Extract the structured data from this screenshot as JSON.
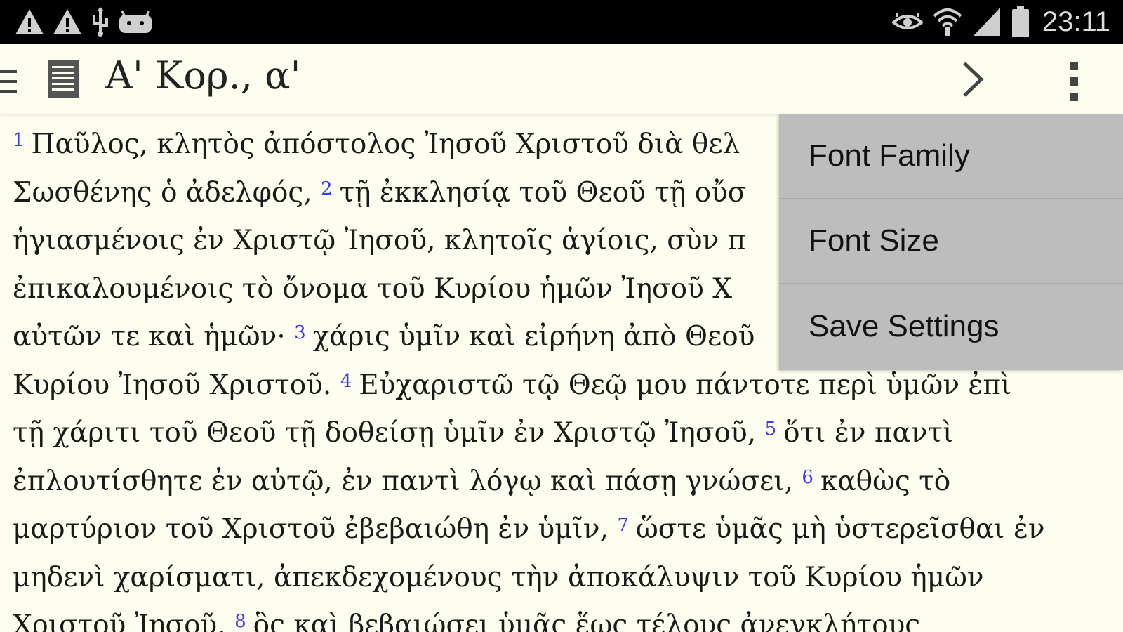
{
  "status_bar": {
    "icons_left": [
      "warning-icon",
      "warning-icon",
      "usb-icon",
      "android-debug-icon"
    ],
    "icons_right": [
      "eye-icon",
      "wifi-icon",
      "signal-icon",
      "battery-icon"
    ],
    "time": "23:11"
  },
  "toolbar": {
    "title": "Α' Κορ., α'",
    "icons": [
      "drawer-icon",
      "book-icon",
      "chevron-right-icon",
      "overflow-menu-icon"
    ]
  },
  "verse_color": "#3a3aef",
  "content": {
    "lines": [
      [
        {
          "v": "1"
        },
        {
          "t": "Παῦλος, κλητὸς ἀπόστολος Ἰησοῦ Χριστοῦ διὰ θελ"
        }
      ],
      [
        {
          "t": "Σωσθένης ὁ ἀδελφός, "
        },
        {
          "v": "2"
        },
        {
          "t": "τῇ ἐκκλησίᾳ τοῦ Θεοῦ τῇ οὔσ"
        }
      ],
      [
        {
          "t": "ἡγιασμένοις ἐν Χριστῷ Ἰησοῦ, κλητοῖς ἁγίοις, σὺν π"
        }
      ],
      [
        {
          "t": "ἐπικαλουμένοις τὸ ὄνομα τοῦ Κυρίου ἡμῶν Ἰησοῦ Χ"
        }
      ],
      [
        {
          "t": "αὐτῶν τε καὶ ἡμῶν· "
        },
        {
          "v": "3"
        },
        {
          "t": "χάρις ὑμῖν καὶ εἰρήνη ἀπὸ Θεοῦ"
        }
      ],
      [
        {
          "t": "Κυρίου Ἰησοῦ Χριστοῦ. "
        },
        {
          "v": "4"
        },
        {
          "t": "Εὐχαριστῶ τῷ Θεῷ μου πάντοτε περὶ ὑμῶν ἐπὶ"
        }
      ],
      [
        {
          "t": "τῇ χάριτι τοῦ Θεοῦ τῇ δοθείσῃ ὑμῖν ἐν Χριστῷ Ἰησοῦ, "
        },
        {
          "v": "5"
        },
        {
          "t": "ὅτι ἐν παντὶ"
        }
      ],
      [
        {
          "t": "ἐπλουτίσθητε ἐν αὐτῷ, ἐν παντὶ λόγῳ καὶ πάσῃ γνώσει, "
        },
        {
          "v": "6"
        },
        {
          "t": "καθὼς τὸ"
        }
      ],
      [
        {
          "t": "μαρτύριον τοῦ Χριστοῦ ἐβεβαιώθη ἐν ὑμῖν, "
        },
        {
          "v": "7"
        },
        {
          "t": "ὥστε ὑμᾶς μὴ ὑστερεῖσθαι ἐν"
        }
      ],
      [
        {
          "t": "μηδενὶ χαρίσματι, ἀπεκδεχομένους τὴν ἀποκάλυψιν τοῦ Κυρίου ἡμῶν"
        }
      ],
      [
        {
          "t": "Χριστοῦ Ἰησοῦ, "
        },
        {
          "v": "8"
        },
        {
          "t": "ὃς καὶ βεβαιώσει ὑμᾶς ἕως τέλους ἀνεγκλήτους"
        }
      ]
    ]
  },
  "menu": {
    "items": [
      "Font Family",
      "Font Size",
      "Save Settings"
    ]
  }
}
